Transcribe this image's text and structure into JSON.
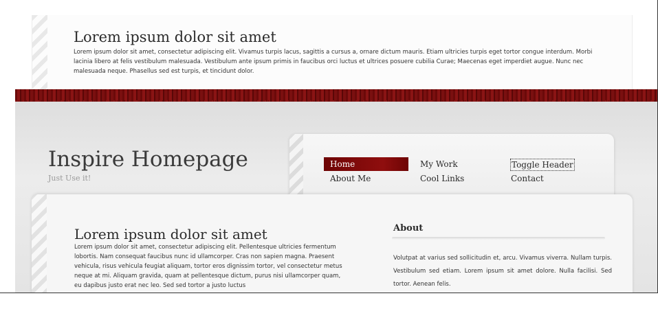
{
  "top_panel": {
    "heading": "Lorem ipsum dolor sit amet",
    "text": "Lorem ipsum dolor sit amet, consectetur adipiscing elit. Vivamus turpis lacus, sagittis a cursus a, ornare dictum mauris. Etiam ultricies turpis eget tortor congue interdum. Morbi lacinia libero at felis vestibulum malesuada. Vestibulum ante ipsum primis in faucibus orci luctus et ultrices posuere cubilia Curae; Maecenas eget imperdiet augue. Nunc nec malesuada neque. Phasellus sed est turpis, et tincidunt dolor."
  },
  "site": {
    "title": "Inspire Homepage",
    "tagline": "Just Use it!"
  },
  "nav": {
    "home": "Home",
    "my_work": "My Work",
    "toggle_header": "Toggle Header",
    "about_me": "About Me",
    "cool_links": "Cool Links",
    "contact": "Contact"
  },
  "content": {
    "heading": "Lorem ipsum dolor sit amet",
    "text": "Lorem ipsum dolor sit amet, consectetur adipiscing elit. Pellentesque ultricies fermentum lobortis. Nam consequat faucibus nunc id ullamcorper. Cras non sapien magna. Praesent vehicula, risus vehicula feugiat aliquam, tortor eros dignissim tortor, vel consectetur metus neque at mi. Aliquam gravida, quam at pellentesque dictum, purus nisi ullamcorper quam, eu dapibus justo erat nec leo. Sed sed tortor a justo luctus"
  },
  "about": {
    "heading": "About",
    "text": "Volutpat at varius sed sollicitudin et, arcu. Vivamus viverra. Nullam turpis. Vestibulum sed etiam. Lorem ipsum sit amet dolore. Nulla facilisi. Sed tortor. Aenean felis."
  },
  "colors": {
    "accent_red": "#8f0e0e",
    "background_grey": "#e4e4e4"
  }
}
